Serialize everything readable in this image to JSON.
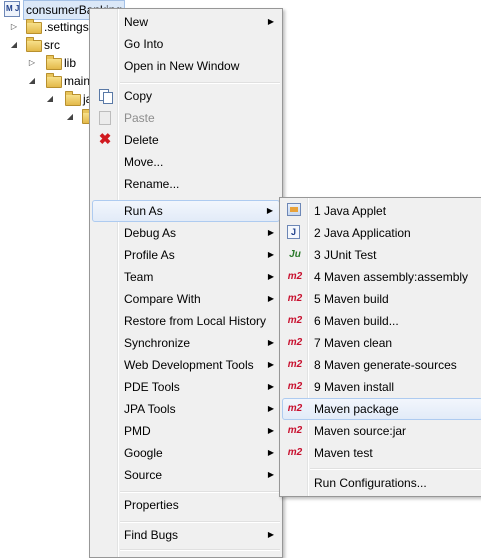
{
  "tree": {
    "project": "consumerBanking",
    "items": [
      {
        "label": ".settings"
      },
      {
        "label": "src"
      },
      {
        "label": "lib"
      },
      {
        "label": "main"
      },
      {
        "label": "ja"
      }
    ]
  },
  "context_menu": {
    "items": [
      {
        "label": "New",
        "submenu": true
      },
      {
        "label": "Go Into"
      },
      {
        "label": "Open in New Window"
      },
      {
        "label": "Copy",
        "icon": "copy-icon"
      },
      {
        "label": "Paste",
        "icon": "paste-icon",
        "disabled": true
      },
      {
        "label": "Delete",
        "icon": "delete-icon"
      },
      {
        "label": "Move..."
      },
      {
        "label": "Rename..."
      },
      {
        "label": "Run As",
        "submenu": true,
        "highlighted": true
      },
      {
        "label": "Debug As",
        "submenu": true
      },
      {
        "label": "Profile As",
        "submenu": true
      },
      {
        "label": "Team",
        "submenu": true
      },
      {
        "label": "Compare With",
        "submenu": true
      },
      {
        "label": "Restore from Local History"
      },
      {
        "label": "Synchronize",
        "submenu": true
      },
      {
        "label": "Web Development Tools",
        "submenu": true
      },
      {
        "label": "PDE Tools",
        "submenu": true
      },
      {
        "label": "JPA Tools",
        "submenu": true
      },
      {
        "label": "PMD",
        "submenu": true
      },
      {
        "label": "Google",
        "submenu": true
      },
      {
        "label": "Source",
        "submenu": true
      },
      {
        "label": "Properties"
      },
      {
        "label": "Find Bugs",
        "submenu": true
      }
    ]
  },
  "run_as_menu": {
    "items": [
      {
        "label": "1 Java Applet",
        "icon": "java-applet-icon"
      },
      {
        "label": "2 Java Application",
        "icon": "java-application-icon",
        "icon_text": "J"
      },
      {
        "label": "3 JUnit Test",
        "icon": "junit-icon",
        "icon_text": "Ju"
      },
      {
        "label": "4 Maven assembly:assembly",
        "icon": "maven-icon",
        "icon_text": "m2"
      },
      {
        "label": "5 Maven build",
        "icon": "maven-icon",
        "icon_text": "m2"
      },
      {
        "label": "6 Maven build...",
        "icon": "maven-icon",
        "icon_text": "m2"
      },
      {
        "label": "7 Maven clean",
        "icon": "maven-icon",
        "icon_text": "m2"
      },
      {
        "label": "8 Maven generate-sources",
        "icon": "maven-icon",
        "icon_text": "m2"
      },
      {
        "label": "9 Maven install",
        "icon": "maven-icon",
        "icon_text": "m2"
      },
      {
        "label": "Maven package",
        "icon": "maven-icon",
        "icon_text": "m2",
        "highlighted": true
      },
      {
        "label": "Maven source:jar",
        "icon": "maven-icon",
        "icon_text": "m2"
      },
      {
        "label": "Maven test",
        "icon": "maven-icon",
        "icon_text": "m2"
      },
      {
        "label": "Run Configurations..."
      }
    ]
  },
  "arrow_glyph": "▶",
  "tree_glyphs": {
    "expanded": "◢",
    "collapsed": "▷"
  },
  "colors": {
    "maven": "#c8102e",
    "highlight_border": "#aecbf0",
    "menu_bg": "#f0f0f0"
  }
}
